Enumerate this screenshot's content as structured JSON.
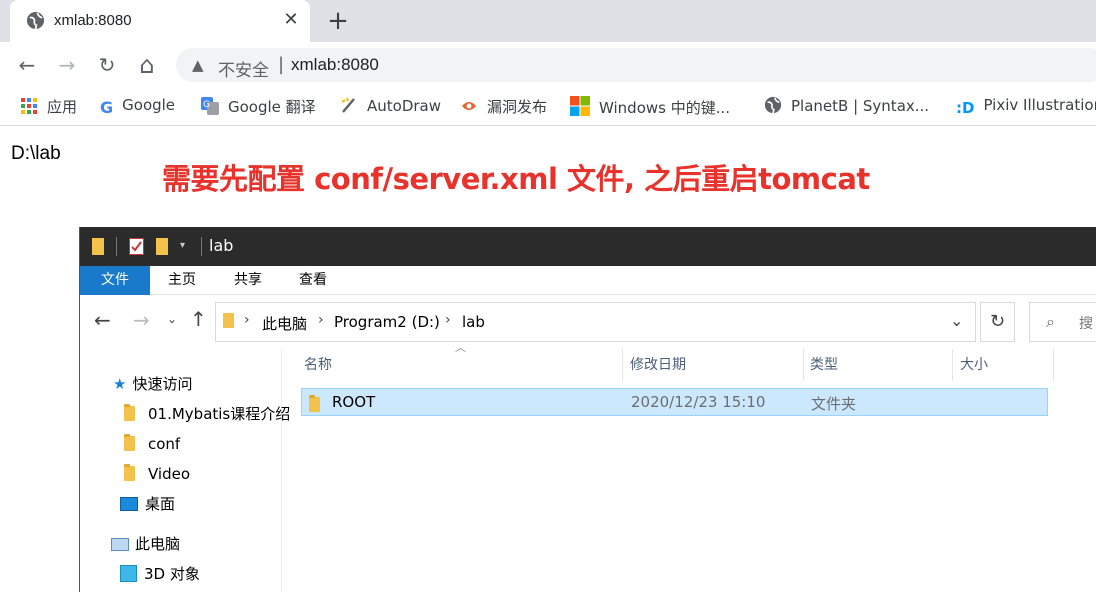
{
  "browser": {
    "tab_title": "xmlab:8080",
    "tab_close": "✕",
    "new_tab": "+",
    "nav": {
      "back": "←",
      "forward": "→",
      "reload": "↻",
      "home": "⌂"
    },
    "omnibox": {
      "warning_icon": "▲",
      "insecure_label": "不安全",
      "separator": "|",
      "url": "xmlab:8080"
    },
    "bookmarks": [
      {
        "label": "应用",
        "icon": "apps-grid-icon"
      },
      {
        "label": "Google",
        "icon": "google-icon"
      },
      {
        "label": "Google 翻译",
        "icon": "google-translate-icon"
      },
      {
        "label": "AutoDraw",
        "icon": "autodraw-icon"
      },
      {
        "label": "漏洞发布",
        "icon": "vuln-icon"
      },
      {
        "label": "Windows 中的键...",
        "icon": "windows-icon"
      },
      {
        "label": "PlanetB | Syntax...",
        "icon": "globe-icon"
      },
      {
        "label": "Pixiv Illustration",
        "icon": "pixiv-icon"
      }
    ]
  },
  "page": {
    "body_text": "D:\\lab"
  },
  "annotation": "需要先配置 conf/server.xml 文件, 之后重启tomcat",
  "explorer": {
    "title": "lab",
    "ribbon_tabs": [
      "文件",
      "主页",
      "共享",
      "查看"
    ],
    "breadcrumb": [
      "此电脑",
      "Program2 (D:)",
      "lab"
    ],
    "search_placeholder": "搜",
    "nav_groups": {
      "quick_access": "快速访问",
      "quick_items": [
        "01.Mybatis课程介绍",
        "conf",
        "Video",
        "桌面"
      ],
      "this_pc": "此电脑",
      "pc_items": [
        "3D 对象"
      ]
    },
    "columns": [
      "名称",
      "修改日期",
      "类型",
      "大小"
    ],
    "rows": [
      {
        "name": "ROOT",
        "modified": "2020/12/23 15:10",
        "type": "文件夹",
        "size": ""
      }
    ]
  },
  "colors": {
    "annotation": "#e8322c",
    "ribbon_file_tab": "#1979ca",
    "selected_row": "#cce8ff",
    "titlebar": "#2b2b2b"
  }
}
